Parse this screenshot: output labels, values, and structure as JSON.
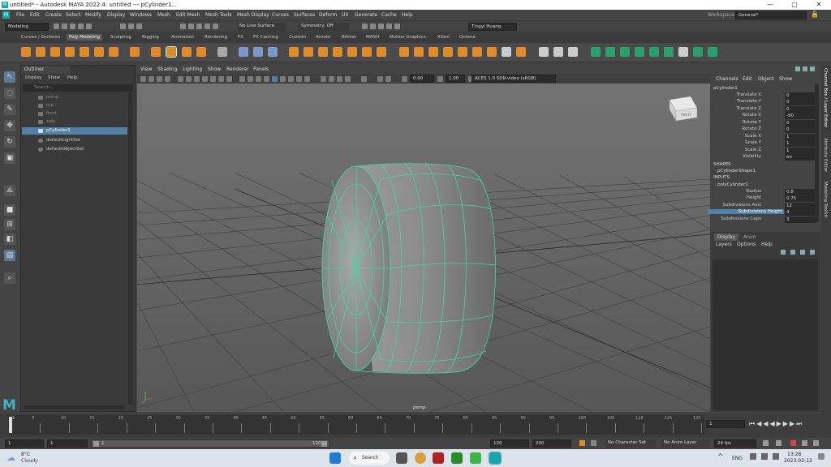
{
  "window": {
    "title": "untitled* - Autodesk MAYA 2022.4: untitled  ---  pCylinder1...",
    "logo": "M",
    "min": "—",
    "max": "▢",
    "close": "✕"
  },
  "menubar": {
    "items": [
      "File",
      "Edit",
      "Create",
      "Select",
      "Modify",
      "Display",
      "Windows",
      "Mesh",
      "Edit Mesh",
      "Mesh Tools",
      "Mesh Display",
      "Curves",
      "Surfaces",
      "Deform",
      "UV",
      "Generate",
      "Cache",
      "Help"
    ],
    "workspace_label": "Workspace :",
    "workspace_value": "General*"
  },
  "statusline": {
    "mode": "Modeling",
    "live_surface": "No Live Surface",
    "symmetry": "Symmetry: Off",
    "user": "Tingyi Huang"
  },
  "shelf_tabs": [
    "Curves / Surfaces",
    "Poly Modeling",
    "Sculpting",
    "Rigging",
    "Animation",
    "Rendering",
    "FX",
    "FX Caching",
    "Custom",
    "Arnold",
    "Bifrost",
    "MASH",
    "Motion Graphics",
    "XGen",
    "Octane"
  ],
  "active_shelf": "Poly Modeling",
  "outliner": {
    "title": "Outliner",
    "menu": [
      "Display",
      "Show",
      "Help"
    ],
    "search_placeholder": "Search...",
    "items": [
      {
        "label": "persp",
        "state": "dim"
      },
      {
        "label": "top",
        "state": "dim"
      },
      {
        "label": "front",
        "state": "dim"
      },
      {
        "label": "side",
        "state": "dim"
      },
      {
        "label": "pCylinder1",
        "state": "sel"
      },
      {
        "label": "defaultLightSet",
        "state": "normal"
      },
      {
        "label": "defaultObjectSet",
        "state": "normal"
      }
    ]
  },
  "viewport": {
    "menu": [
      "View",
      "Shading",
      "Lighting",
      "Show",
      "Renderer",
      "Panels"
    ],
    "exposure": "0.00",
    "gamma": "1.00",
    "color_space": "ACES 1.0 SDR-video (sRGB)",
    "camera_label": "persp",
    "viewcube_label": "RIGHT"
  },
  "channel_box": {
    "menu": [
      "Channels",
      "Edit",
      "Object",
      "Show"
    ],
    "object": "pCylinder1",
    "attributes": [
      {
        "name": "Translate X",
        "value": "0"
      },
      {
        "name": "Translate Y",
        "value": "0"
      },
      {
        "name": "Translate Z",
        "value": "0"
      },
      {
        "name": "Rotate X",
        "value": "-90"
      },
      {
        "name": "Rotate Y",
        "value": "0"
      },
      {
        "name": "Rotate Z",
        "value": "0"
      },
      {
        "name": "Scale X",
        "value": "1"
      },
      {
        "name": "Scale Y",
        "value": "1"
      },
      {
        "name": "Scale Z",
        "value": "1"
      },
      {
        "name": "Visibility",
        "value": "on"
      }
    ],
    "shapes_label": "SHAPES",
    "shape_name": "pCylinderShape1",
    "inputs_label": "INPUTS",
    "input_name": "polyCylinder1",
    "inputs": [
      {
        "name": "Radius",
        "value": "0.8"
      },
      {
        "name": "Height",
        "value": "0.75"
      },
      {
        "name": "Subdivisions Axis",
        "value": "12"
      },
      {
        "name": "Subdivisions Height",
        "value": "4"
      },
      {
        "name": "Subdivisions Caps",
        "value": "3"
      }
    ]
  },
  "layer_editor": {
    "tabs": [
      "Display",
      "Anim"
    ],
    "menu": [
      "Layers",
      "Options",
      "Help"
    ]
  },
  "side_tabs": [
    "Channel Box / Layer Editor",
    "Attribute Editor",
    "Modeling Toolkit"
  ],
  "timeline": {
    "ticks": [
      "5",
      "10",
      "15",
      "20",
      "25",
      "30",
      "35",
      "40",
      "45",
      "50",
      "55",
      "60",
      "65",
      "70",
      "75",
      "80",
      "85",
      "90",
      "95",
      "100",
      "105",
      "110",
      "115",
      "120"
    ],
    "start_label": "1",
    "current_frame": "1"
  },
  "range": {
    "start": "1",
    "start2": "1",
    "slider_start": "1",
    "slider_end": "120",
    "end": "120",
    "end2": "200",
    "character_set": "No Character Set",
    "anim_layer": "No Anim Layer",
    "fps": "24 fps"
  },
  "taskbar": {
    "temperature": "8°C",
    "weather": "Cloudy",
    "search": "Search",
    "language": "ENG",
    "time": "13:26",
    "date": "2023-02-12"
  }
}
